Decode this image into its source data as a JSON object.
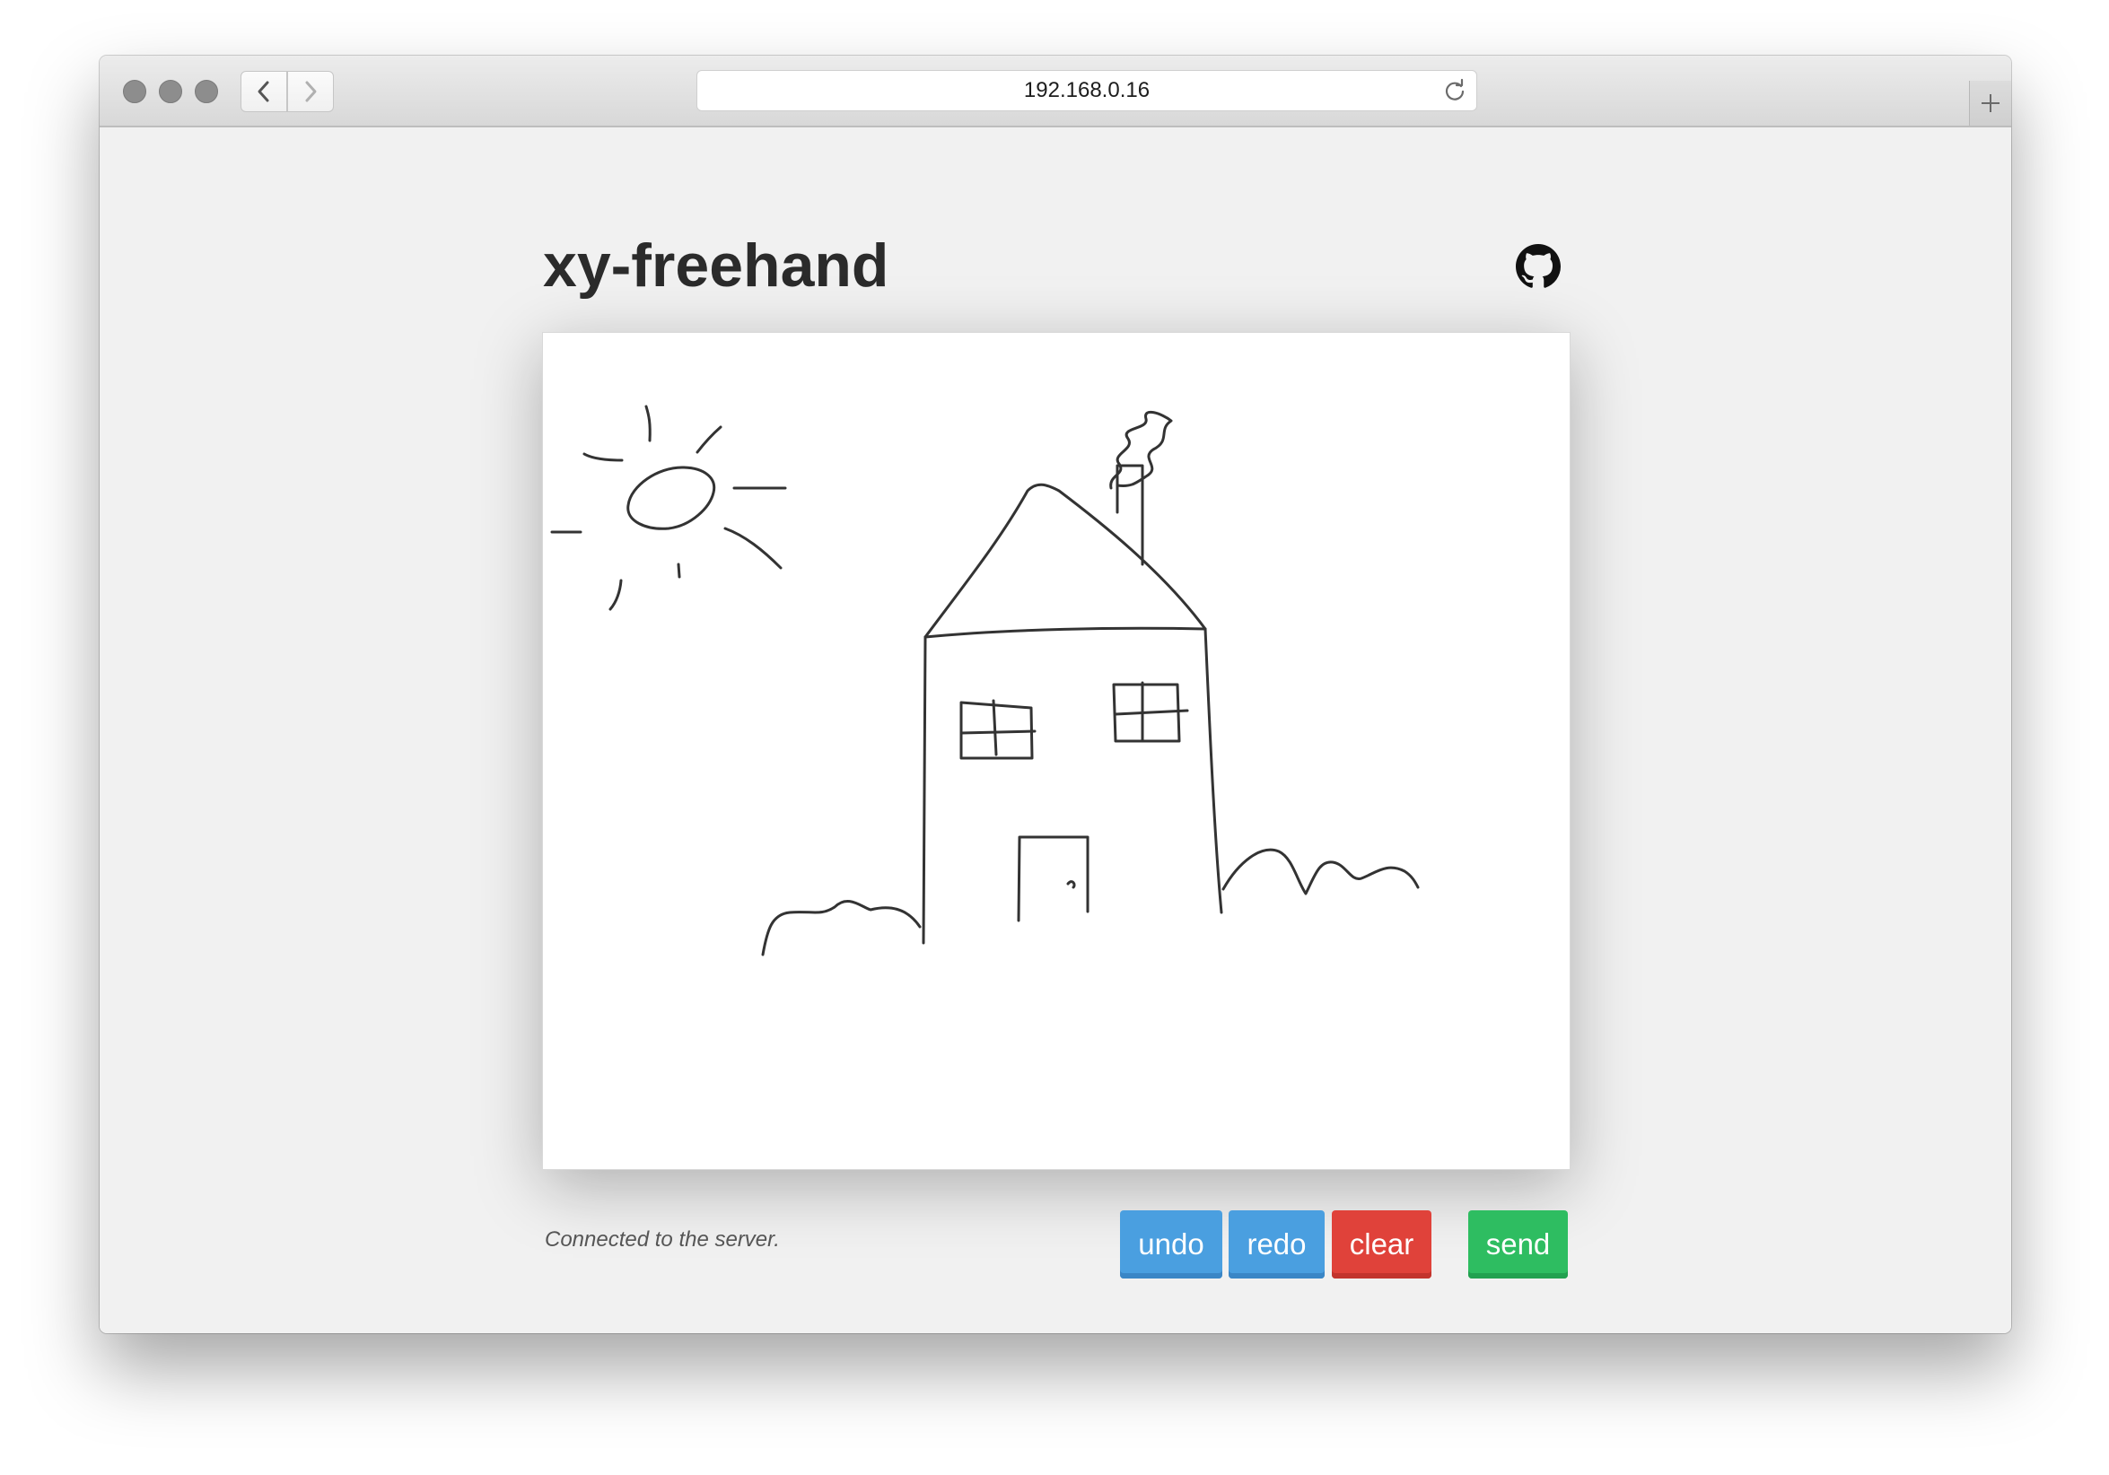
{
  "browser": {
    "url": "192.168.0.16",
    "back_icon": "chevron-left-icon",
    "forward_icon": "chevron-right-icon",
    "reload_icon": "reload-icon",
    "new_tab_icon": "plus-icon"
  },
  "page": {
    "title": "xy-freehand",
    "github_icon": "github-icon",
    "canvas_content": "freehand drawing: sun, house with chimney and smoke, two windows, door, grass"
  },
  "status": {
    "text": "Connected to the server."
  },
  "buttons": {
    "undo": "undo",
    "redo": "redo",
    "clear": "clear",
    "send": "send"
  },
  "colors": {
    "undo": "#4a9fe0",
    "redo": "#4a9fe0",
    "clear": "#e0423a",
    "send": "#2ebd61"
  }
}
